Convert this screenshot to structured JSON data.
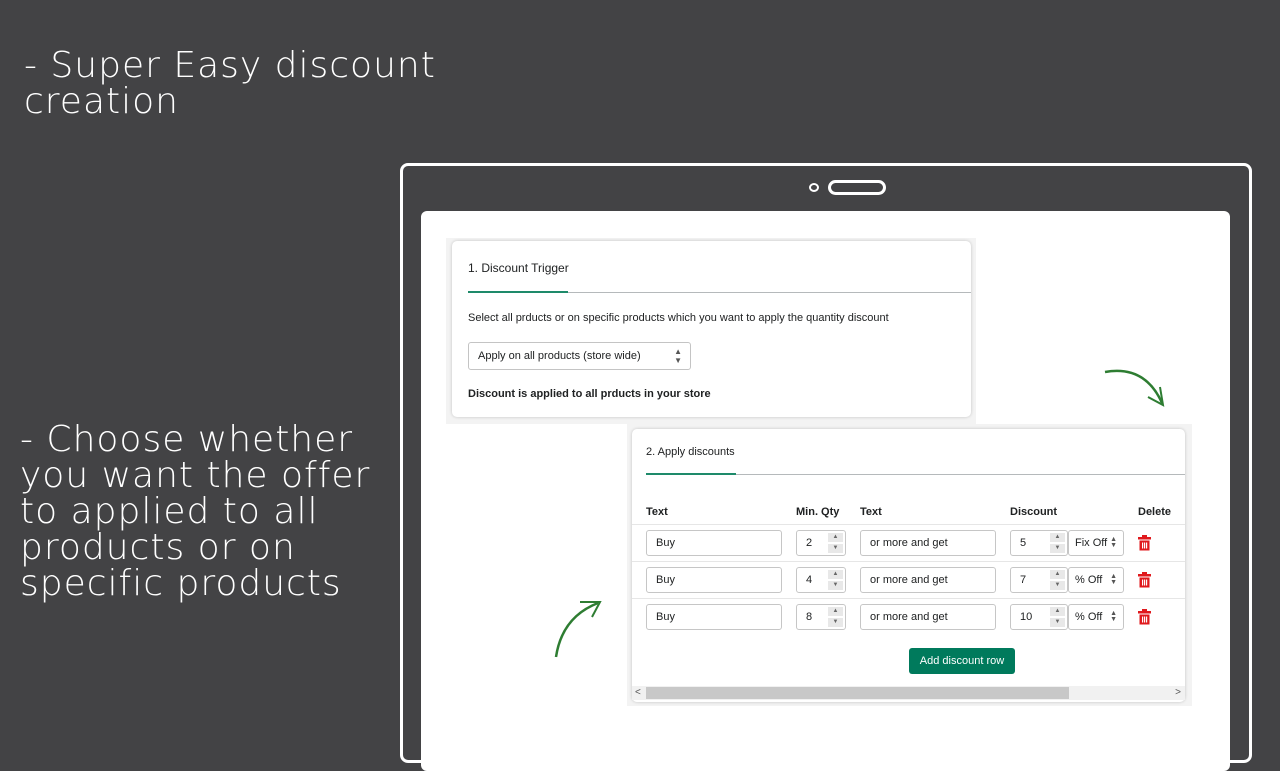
{
  "captions": {
    "top": "- Super Easy discount creation",
    "bottom": "- Choose whether you want the offer to applied to all products or on specific products"
  },
  "trigger": {
    "title": "1. Discount Trigger",
    "description": "Select all prducts or on specific products which you want to apply the quantity discount",
    "select_value": "Apply on all products (store wide)",
    "note": "Discount is applied to all prducts in your store"
  },
  "discounts": {
    "title": "2. Apply discounts",
    "headers": {
      "text": "Text",
      "min_qty": "Min. Qty",
      "text2": "Text",
      "discount": "Discount",
      "delete": "Delete"
    },
    "rows": [
      {
        "text": "Buy",
        "qty": "2",
        "text2": "or more and get",
        "discount": "5",
        "type": "Fix Off"
      },
      {
        "text": "Buy",
        "qty": "4",
        "text2": "or more and get",
        "discount": "7",
        "type": "% Off"
      },
      {
        "text": "Buy",
        "qty": "8",
        "text2": "or more and get",
        "discount": "10",
        "type": "% Off"
      }
    ],
    "add_button": "Add discount row"
  },
  "colors": {
    "accent": "#007a5c",
    "delete": "#e0191d",
    "background": "#434345"
  }
}
